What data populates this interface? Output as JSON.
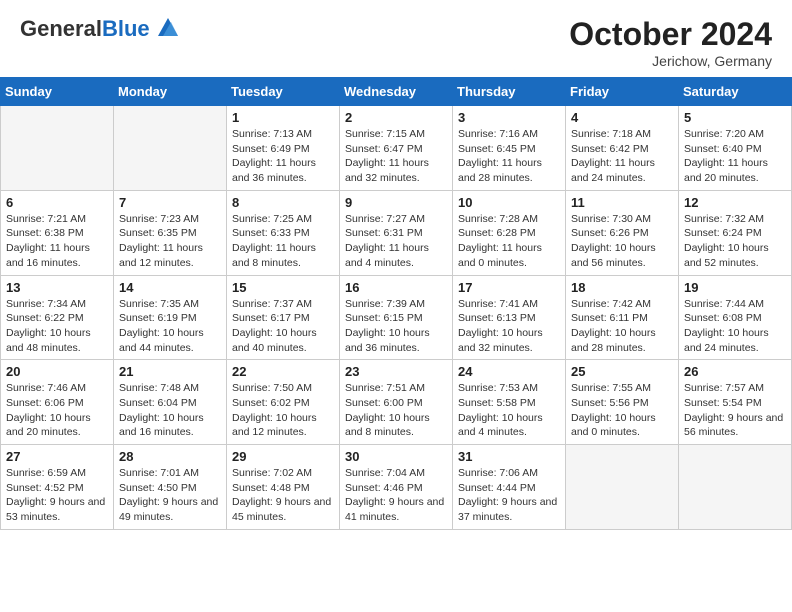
{
  "header": {
    "logo_general": "General",
    "logo_blue": "Blue",
    "month_year": "October 2024",
    "location": "Jerichow, Germany"
  },
  "days_of_week": [
    "Sunday",
    "Monday",
    "Tuesday",
    "Wednesday",
    "Thursday",
    "Friday",
    "Saturday"
  ],
  "weeks": [
    [
      {
        "day": "",
        "sunrise": "",
        "sunset": "",
        "daylight": ""
      },
      {
        "day": "",
        "sunrise": "",
        "sunset": "",
        "daylight": ""
      },
      {
        "day": "1",
        "sunrise": "Sunrise: 7:13 AM",
        "sunset": "Sunset: 6:49 PM",
        "daylight": "Daylight: 11 hours and 36 minutes."
      },
      {
        "day": "2",
        "sunrise": "Sunrise: 7:15 AM",
        "sunset": "Sunset: 6:47 PM",
        "daylight": "Daylight: 11 hours and 32 minutes."
      },
      {
        "day": "3",
        "sunrise": "Sunrise: 7:16 AM",
        "sunset": "Sunset: 6:45 PM",
        "daylight": "Daylight: 11 hours and 28 minutes."
      },
      {
        "day": "4",
        "sunrise": "Sunrise: 7:18 AM",
        "sunset": "Sunset: 6:42 PM",
        "daylight": "Daylight: 11 hours and 24 minutes."
      },
      {
        "day": "5",
        "sunrise": "Sunrise: 7:20 AM",
        "sunset": "Sunset: 6:40 PM",
        "daylight": "Daylight: 11 hours and 20 minutes."
      }
    ],
    [
      {
        "day": "6",
        "sunrise": "Sunrise: 7:21 AM",
        "sunset": "Sunset: 6:38 PM",
        "daylight": "Daylight: 11 hours and 16 minutes."
      },
      {
        "day": "7",
        "sunrise": "Sunrise: 7:23 AM",
        "sunset": "Sunset: 6:35 PM",
        "daylight": "Daylight: 11 hours and 12 minutes."
      },
      {
        "day": "8",
        "sunrise": "Sunrise: 7:25 AM",
        "sunset": "Sunset: 6:33 PM",
        "daylight": "Daylight: 11 hours and 8 minutes."
      },
      {
        "day": "9",
        "sunrise": "Sunrise: 7:27 AM",
        "sunset": "Sunset: 6:31 PM",
        "daylight": "Daylight: 11 hours and 4 minutes."
      },
      {
        "day": "10",
        "sunrise": "Sunrise: 7:28 AM",
        "sunset": "Sunset: 6:28 PM",
        "daylight": "Daylight: 11 hours and 0 minutes."
      },
      {
        "day": "11",
        "sunrise": "Sunrise: 7:30 AM",
        "sunset": "Sunset: 6:26 PM",
        "daylight": "Daylight: 10 hours and 56 minutes."
      },
      {
        "day": "12",
        "sunrise": "Sunrise: 7:32 AM",
        "sunset": "Sunset: 6:24 PM",
        "daylight": "Daylight: 10 hours and 52 minutes."
      }
    ],
    [
      {
        "day": "13",
        "sunrise": "Sunrise: 7:34 AM",
        "sunset": "Sunset: 6:22 PM",
        "daylight": "Daylight: 10 hours and 48 minutes."
      },
      {
        "day": "14",
        "sunrise": "Sunrise: 7:35 AM",
        "sunset": "Sunset: 6:19 PM",
        "daylight": "Daylight: 10 hours and 44 minutes."
      },
      {
        "day": "15",
        "sunrise": "Sunrise: 7:37 AM",
        "sunset": "Sunset: 6:17 PM",
        "daylight": "Daylight: 10 hours and 40 minutes."
      },
      {
        "day": "16",
        "sunrise": "Sunrise: 7:39 AM",
        "sunset": "Sunset: 6:15 PM",
        "daylight": "Daylight: 10 hours and 36 minutes."
      },
      {
        "day": "17",
        "sunrise": "Sunrise: 7:41 AM",
        "sunset": "Sunset: 6:13 PM",
        "daylight": "Daylight: 10 hours and 32 minutes."
      },
      {
        "day": "18",
        "sunrise": "Sunrise: 7:42 AM",
        "sunset": "Sunset: 6:11 PM",
        "daylight": "Daylight: 10 hours and 28 minutes."
      },
      {
        "day": "19",
        "sunrise": "Sunrise: 7:44 AM",
        "sunset": "Sunset: 6:08 PM",
        "daylight": "Daylight: 10 hours and 24 minutes."
      }
    ],
    [
      {
        "day": "20",
        "sunrise": "Sunrise: 7:46 AM",
        "sunset": "Sunset: 6:06 PM",
        "daylight": "Daylight: 10 hours and 20 minutes."
      },
      {
        "day": "21",
        "sunrise": "Sunrise: 7:48 AM",
        "sunset": "Sunset: 6:04 PM",
        "daylight": "Daylight: 10 hours and 16 minutes."
      },
      {
        "day": "22",
        "sunrise": "Sunrise: 7:50 AM",
        "sunset": "Sunset: 6:02 PM",
        "daylight": "Daylight: 10 hours and 12 minutes."
      },
      {
        "day": "23",
        "sunrise": "Sunrise: 7:51 AM",
        "sunset": "Sunset: 6:00 PM",
        "daylight": "Daylight: 10 hours and 8 minutes."
      },
      {
        "day": "24",
        "sunrise": "Sunrise: 7:53 AM",
        "sunset": "Sunset: 5:58 PM",
        "daylight": "Daylight: 10 hours and 4 minutes."
      },
      {
        "day": "25",
        "sunrise": "Sunrise: 7:55 AM",
        "sunset": "Sunset: 5:56 PM",
        "daylight": "Daylight: 10 hours and 0 minutes."
      },
      {
        "day": "26",
        "sunrise": "Sunrise: 7:57 AM",
        "sunset": "Sunset: 5:54 PM",
        "daylight": "Daylight: 9 hours and 56 minutes."
      }
    ],
    [
      {
        "day": "27",
        "sunrise": "Sunrise: 6:59 AM",
        "sunset": "Sunset: 4:52 PM",
        "daylight": "Daylight: 9 hours and 53 minutes."
      },
      {
        "day": "28",
        "sunrise": "Sunrise: 7:01 AM",
        "sunset": "Sunset: 4:50 PM",
        "daylight": "Daylight: 9 hours and 49 minutes."
      },
      {
        "day": "29",
        "sunrise": "Sunrise: 7:02 AM",
        "sunset": "Sunset: 4:48 PM",
        "daylight": "Daylight: 9 hours and 45 minutes."
      },
      {
        "day": "30",
        "sunrise": "Sunrise: 7:04 AM",
        "sunset": "Sunset: 4:46 PM",
        "daylight": "Daylight: 9 hours and 41 minutes."
      },
      {
        "day": "31",
        "sunrise": "Sunrise: 7:06 AM",
        "sunset": "Sunset: 4:44 PM",
        "daylight": "Daylight: 9 hours and 37 minutes."
      },
      {
        "day": "",
        "sunrise": "",
        "sunset": "",
        "daylight": ""
      },
      {
        "day": "",
        "sunrise": "",
        "sunset": "",
        "daylight": ""
      }
    ]
  ]
}
